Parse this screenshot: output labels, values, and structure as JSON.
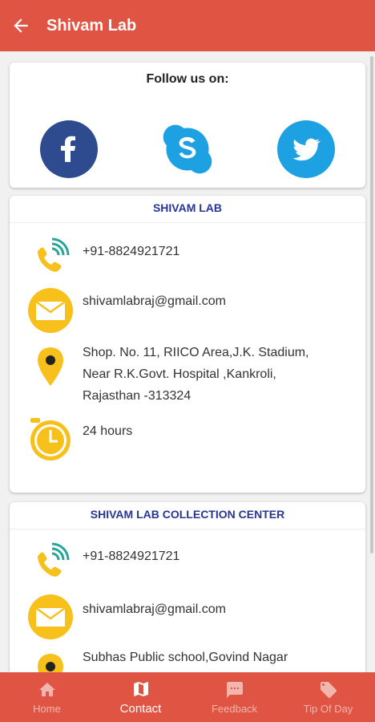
{
  "appbar": {
    "title": "Shivam Lab",
    "back_icon": "arrow-back-icon"
  },
  "follow": {
    "title": "Follow us on:",
    "socials": [
      {
        "name": "facebook",
        "icon": "facebook-icon",
        "color": "#2d4b8e"
      },
      {
        "name": "skype",
        "icon": "skype-icon",
        "color": "#1da1e2"
      },
      {
        "name": "twitter",
        "icon": "twitter-icon",
        "color": "#1da1e2"
      }
    ]
  },
  "lab": {
    "title": "SHIVAM LAB",
    "phone": "+91-8824921721",
    "email": "shivamlabraj@gmail.com",
    "address_line1": "Shop. No. 11, RIICO Area,J.K. Stadium,",
    "address_line2": "Near R.K.Govt. Hospital ,Kankroli,",
    "address_line3": "Rajasthan -313324",
    "hours": "24 hours"
  },
  "center": {
    "title": "SHIVAM LAB COLLECTION CENTER",
    "phone": "+91-8824921721",
    "email": "shivamlabraj@gmail.com",
    "address_line1": "Subhas Public school,Govind Nagar"
  },
  "bottom_nav": {
    "home": "Home",
    "contact": "Contact",
    "feedback": "Feedback",
    "tip": "Tip Of Day",
    "active": "contact"
  },
  "colors": {
    "primary": "#e05444",
    "accent_yellow": "#f7c01b",
    "section_title": "#283593"
  }
}
